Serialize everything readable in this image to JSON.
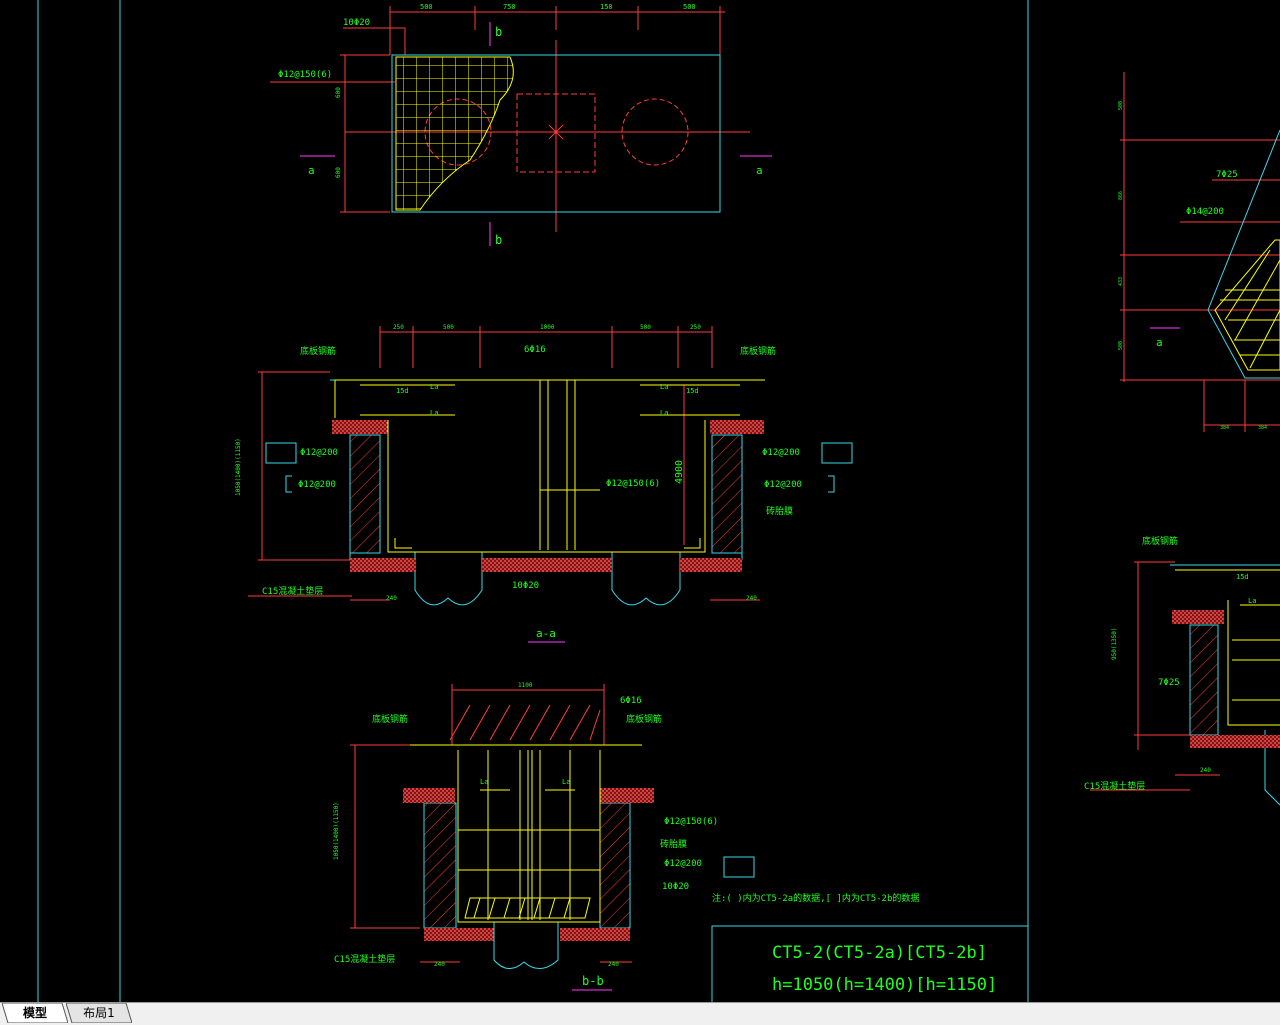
{
  "tabs": [
    {
      "label": "模型",
      "active": true
    },
    {
      "label": "布局1",
      "active": false
    }
  ],
  "plan": {
    "dims_top": [
      "500",
      "750",
      "150",
      "500"
    ],
    "rebar_top": "10Φ20",
    "rebar_side": "Φ12@150(6)",
    "dim_left_top": "600",
    "dim_left_bottom": "600",
    "section_b_top": "b",
    "section_b_bottom": "b",
    "section_a_left": "a",
    "section_a_right": "a"
  },
  "section_aa": {
    "dims_top": [
      "250",
      "500",
      "1000",
      "500",
      "250"
    ],
    "label_bottom_rebar_left": "底板钢筋",
    "label_bottom_rebar_right": "底板钢筋",
    "rebar_top_center": "6Φ16",
    "la1": "La",
    "la2": "La",
    "la3": "La",
    "la4": "La",
    "d15_left": "15d",
    "d15_right": "15d",
    "rebar_l1": "Φ12@200",
    "rebar_l2": "Φ12@200",
    "rebar_r1": "Φ12@200",
    "rebar_r2": "Φ12@200",
    "rebar_center": "Φ12@150(6)",
    "dim_vertical_red": "4900",
    "label_brick_mold": "砖胎膜",
    "rebar_bottom": "10Φ20",
    "label_cushion": "C15混凝土垫层",
    "dim_left_v": "1050(1400)(1150)",
    "dim_240_left": "240",
    "dim_240_right": "240",
    "title": "a-a"
  },
  "section_bb": {
    "dim_top": "1100",
    "rebar_top": "6Φ16",
    "label_bottom_rebar_left": "底板钢筋",
    "label_bottom_rebar_right": "底板钢筋",
    "la_left": "La",
    "la_right": "La",
    "rebar_1": "Φ12@150(6)",
    "label_brick_mold": "砖胎膜",
    "rebar_2": "Φ12@200",
    "rebar_3": "10Φ20",
    "label_cushion": "C15混凝土垫层",
    "dim_left_v": "1050(1400)(1150)",
    "dim_240_left": "240",
    "dim_240_right": "240",
    "title": "b-b"
  },
  "note": "注:( )内为CT5-2a的数据,[ ]内为CT5-2b的数据",
  "title_block": {
    "line1": "CT5-2(CT5-2a)[CT5-2b]",
    "line2": "h=1050(h=1400)[h=1150]"
  },
  "right_plan": {
    "rebar_a": "7Φ25",
    "rebar_b": "Φ14@200",
    "section_a": "a",
    "dims_left": [
      "500",
      "866",
      "433",
      "500"
    ],
    "dims_bottom": [
      "384",
      "384"
    ]
  },
  "right_section": {
    "label_bottom_rebar": "底板钢筋",
    "d15": "15d",
    "la": "La",
    "rebar_7": "7Φ25",
    "label_cushion": "C15混凝土垫层",
    "dim_left_v": "950(1350)",
    "dim_240": "240"
  },
  "colors": {
    "background": "#000000",
    "frame": "#39d7e8",
    "dimension": "#ff3c3c",
    "text": "#1fff1f",
    "rebar": "#ffff00",
    "hatch": "#ff3c3c",
    "label_magenta": "#ff3cff",
    "cushion": "#d42a2a"
  }
}
